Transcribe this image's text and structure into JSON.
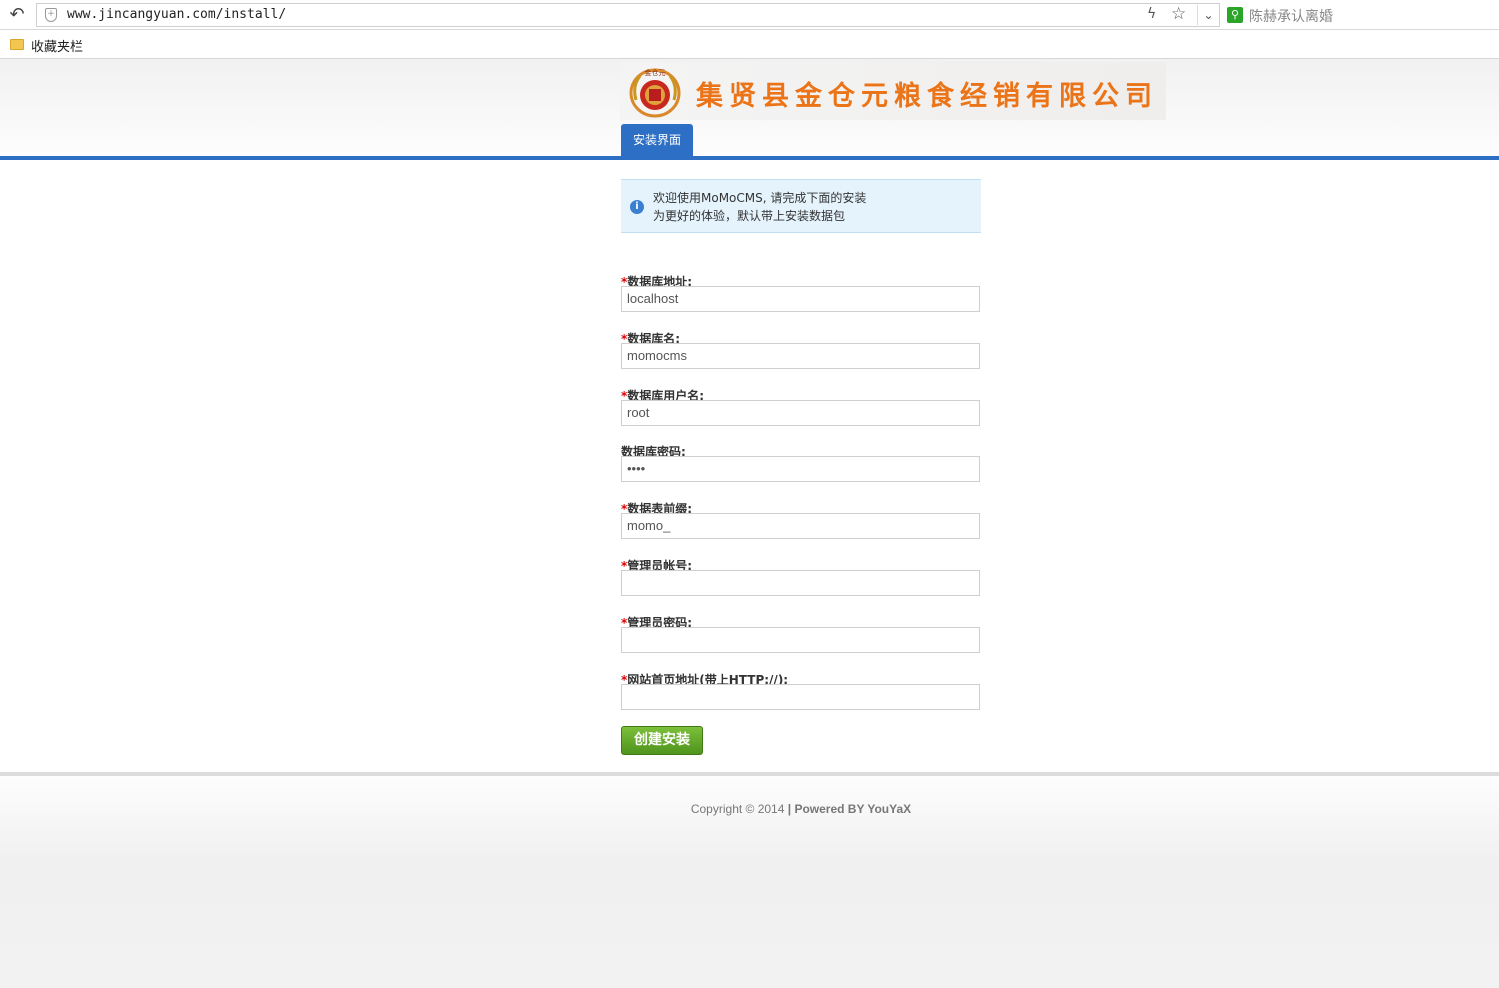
{
  "browser": {
    "url": "www.jincangyuan.com/install/",
    "search_text": "陈赫承认离婚",
    "favorites_label": "收藏夹栏"
  },
  "header": {
    "company_name": "集贤县金仓元粮食经销有限公司",
    "nav_tab": "安装界面"
  },
  "notice": {
    "line1": "欢迎使用MoMoCMS, 请完成下面的安装",
    "line2": "为更好的体验，默认带上安装数据包"
  },
  "form": {
    "fields": [
      {
        "required": true,
        "label": "数据库地址:",
        "value": "localhost"
      },
      {
        "required": true,
        "label": "数据库名:",
        "value": "momocms"
      },
      {
        "required": true,
        "label": "数据库用户名:",
        "value": "root"
      },
      {
        "required": false,
        "label": "数据库密码:",
        "value": "••••"
      },
      {
        "required": true,
        "label": "数据表前缀:",
        "value": "momo_"
      },
      {
        "required": true,
        "label": "管理员帐号:",
        "value": ""
      },
      {
        "required": true,
        "label": "管理员密码:",
        "value": ""
      },
      {
        "required": true,
        "label": "网站首页地址(带上HTTP://):",
        "value": ""
      }
    ],
    "submit_label": "创建安装"
  },
  "footer": {
    "copyright": "Copyright © 2014",
    "powered": "| Powered BY YouYaX"
  },
  "colors": {
    "accent_blue": "#2c6fc4",
    "required_red": "#dd0000",
    "button_green": "#5ea626",
    "logo_orange": "#ec7418"
  }
}
